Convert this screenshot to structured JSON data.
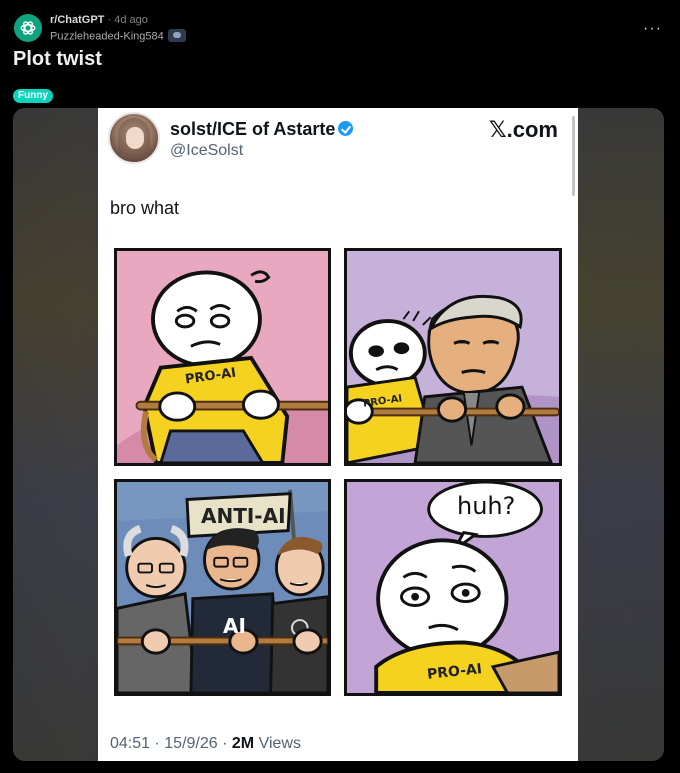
{
  "header": {
    "subreddit": "r/ChatGPT",
    "separator": "·",
    "age": "4d ago",
    "author": "Puzzleheaded-King584",
    "more_label": "···"
  },
  "post": {
    "title": "Plot twist",
    "flair": "Funny"
  },
  "tweet": {
    "display_name": "solst/ICE of Astarte",
    "handle": "@IceSolst",
    "site_x": "𝕏",
    "site_suffix": ".com",
    "text": "bro what",
    "time": "04:51",
    "sep1": "·",
    "date": "15/9/26",
    "sep2": "·",
    "views_count": "2M",
    "views_label": "Views"
  },
  "comic": {
    "panel1_shirt": "PRO-AI",
    "panel2_shirt": "PRO-AI",
    "panel3_flag": "ANTI-AI",
    "panel3_shirt": "AI",
    "panel4_bubble": "huh?",
    "panel4_shirt": "PRO-AI"
  },
  "colors": {
    "flair_bg": "#0dd3bb",
    "subreddit_icon": "#10a37f",
    "verified": "#1d9bf0"
  }
}
